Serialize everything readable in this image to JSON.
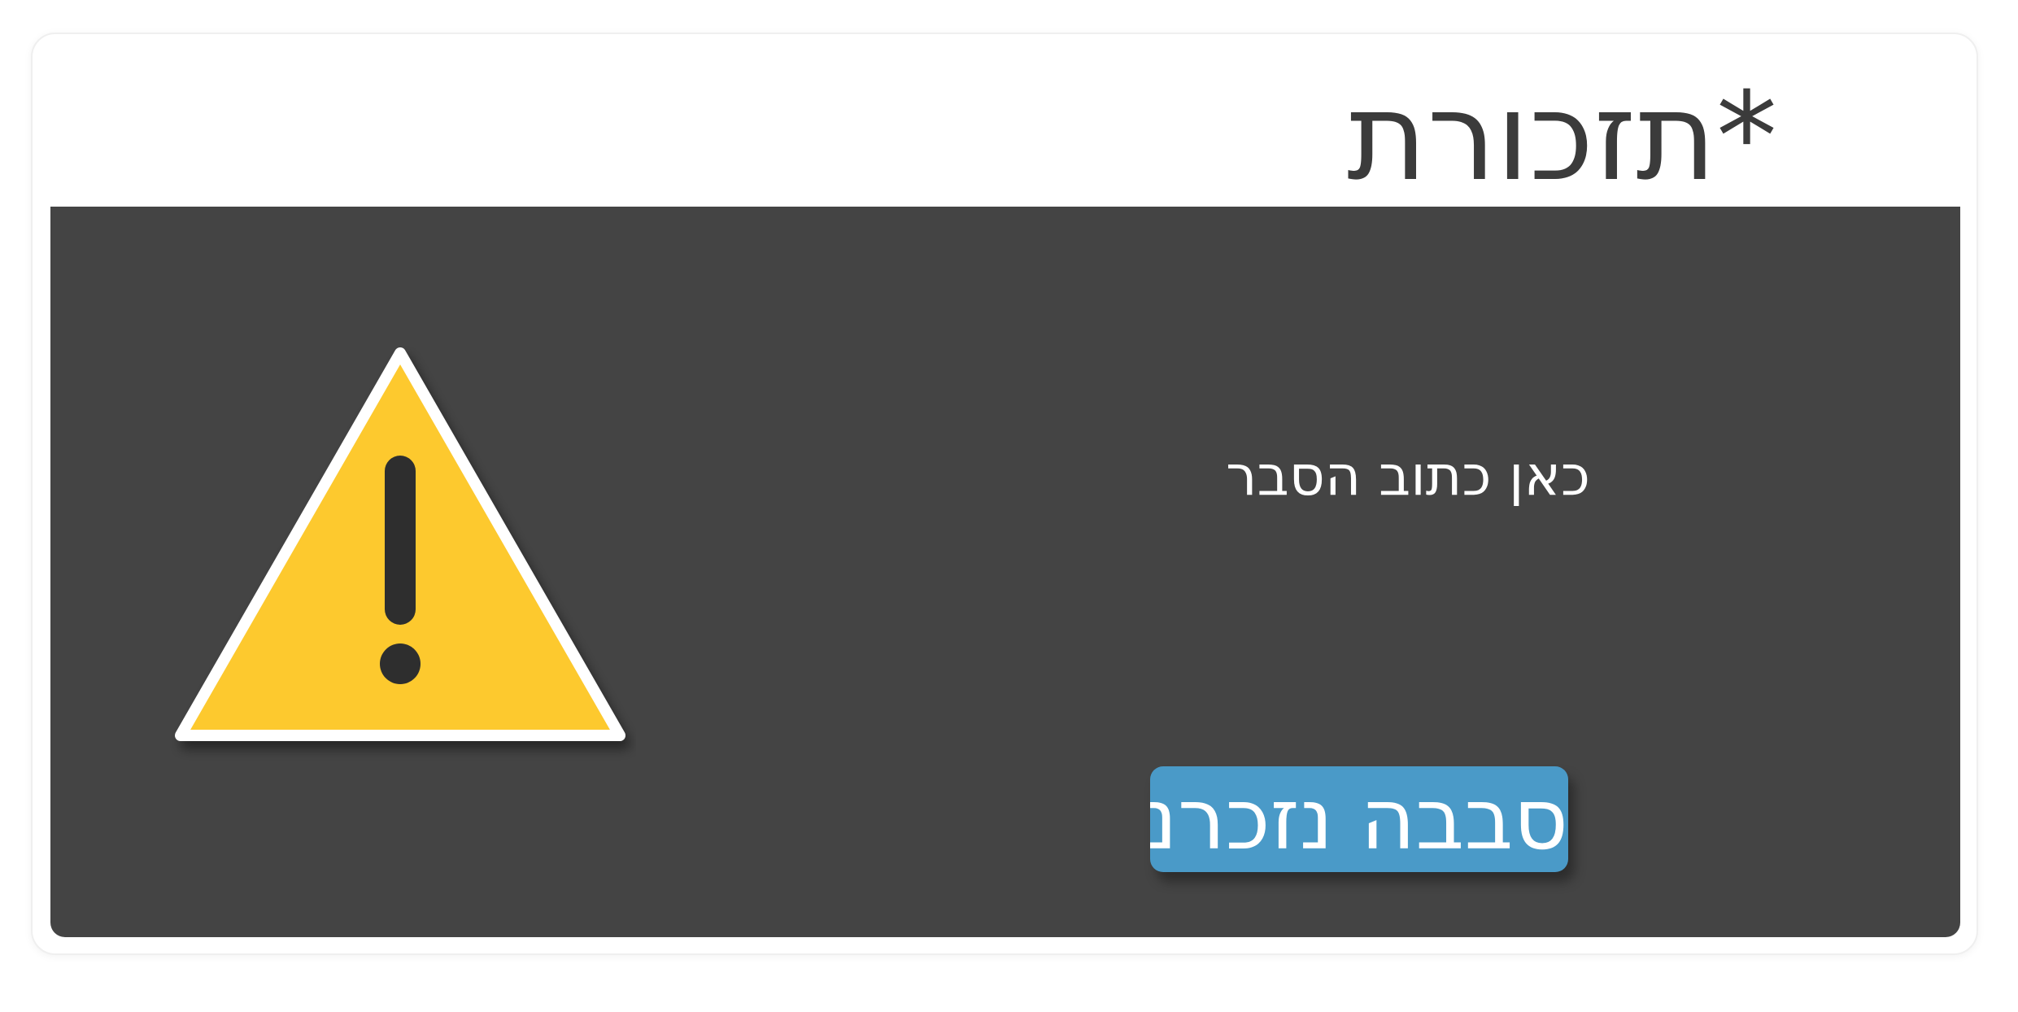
{
  "dialog": {
    "title": "*תזכורת",
    "message": "כאן כתוב הסבר",
    "confirm_label": "סבבה נזכרנו",
    "icon": "warning-triangle-icon"
  },
  "colors": {
    "panel_background": "#444444",
    "title_text": "#3b3b3b",
    "button_background": "#4a9ac8",
    "warning_fill": "#fdc92f",
    "warning_mark": "#2e2e2e"
  }
}
